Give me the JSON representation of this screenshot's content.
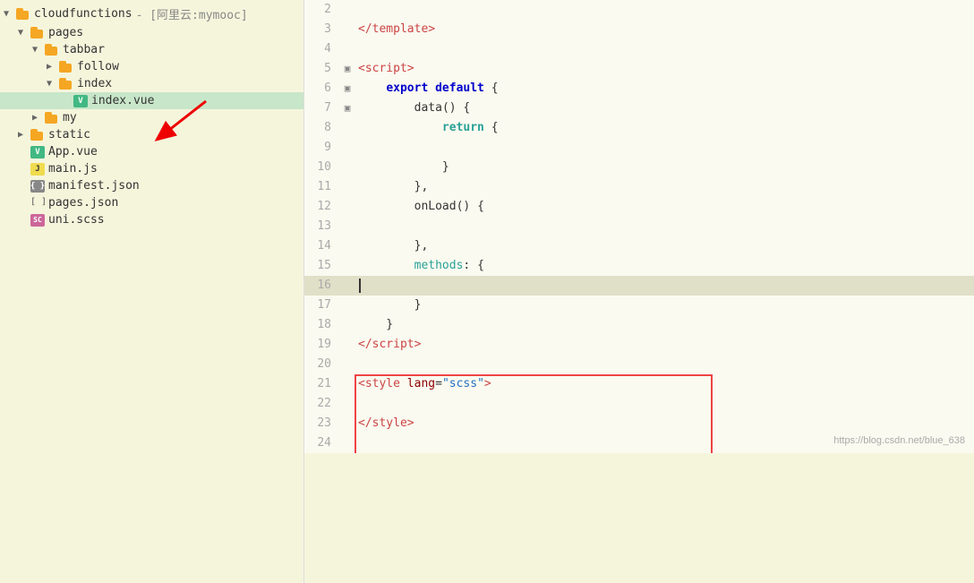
{
  "sidebar": {
    "items": [
      {
        "id": "cloudfunctions",
        "label": "cloudfunctions",
        "suffix": "- [阿里云:mymooc]",
        "type": "folder-open",
        "indent": 0,
        "arrow": "down"
      },
      {
        "id": "pages",
        "label": "pages",
        "type": "folder-open",
        "indent": 1,
        "arrow": "down"
      },
      {
        "id": "tabbar",
        "label": "tabbar",
        "type": "folder-open",
        "indent": 2,
        "arrow": "down"
      },
      {
        "id": "follow",
        "label": "follow",
        "type": "folder-closed",
        "indent": 3,
        "arrow": "right"
      },
      {
        "id": "index",
        "label": "index",
        "type": "folder-open",
        "indent": 3,
        "arrow": "down"
      },
      {
        "id": "index-vue",
        "label": "index.vue",
        "type": "file-vue",
        "indent": 4,
        "arrow": "empty",
        "selected": true
      },
      {
        "id": "my",
        "label": "my",
        "type": "folder-closed",
        "indent": 2,
        "arrow": "right"
      },
      {
        "id": "static",
        "label": "static",
        "type": "folder-closed",
        "indent": 1,
        "arrow": "right"
      },
      {
        "id": "App-vue",
        "label": "App.vue",
        "type": "file-vue",
        "indent": 1,
        "arrow": "empty"
      },
      {
        "id": "main-js",
        "label": "main.js",
        "type": "file-js",
        "indent": 1,
        "arrow": "empty"
      },
      {
        "id": "manifest-json",
        "label": "manifest.json",
        "type": "file-json",
        "indent": 1,
        "arrow": "empty"
      },
      {
        "id": "pages-json",
        "label": "pages.json",
        "type": "file-json",
        "indent": 1,
        "arrow": "empty"
      },
      {
        "id": "uni-scss",
        "label": "uni.scss",
        "type": "file-scss",
        "indent": 1,
        "arrow": "empty"
      }
    ]
  },
  "editor": {
    "lines": [
      {
        "num": 2,
        "fold": "",
        "content": "",
        "type": "plain"
      },
      {
        "num": 3,
        "fold": "",
        "content": "<TEMPLATE_CLOSE>",
        "type": "template-close"
      },
      {
        "num": 4,
        "fold": "",
        "content": "",
        "type": "plain"
      },
      {
        "num": 5,
        "fold": "▣",
        "content": "<SCRIPT_OPEN>",
        "type": "script-open"
      },
      {
        "num": 6,
        "fold": "▣",
        "content": "EXPORT_DEFAULT",
        "type": "export"
      },
      {
        "num": 7,
        "fold": "▣",
        "content": "DATA_FN",
        "type": "data-fn"
      },
      {
        "num": 8,
        "fold": "",
        "content": "RETURN",
        "type": "return"
      },
      {
        "num": 9,
        "fold": "",
        "content": "",
        "type": "plain"
      },
      {
        "num": 10,
        "fold": "",
        "content": "CLOSE_BRACE",
        "type": "close-brace"
      },
      {
        "num": 11,
        "fold": "",
        "content": "CLOSE_BRACE_COMMA",
        "type": "close-brace-comma"
      },
      {
        "num": 12,
        "fold": "",
        "content": "ON_LOAD",
        "type": "onload"
      },
      {
        "num": 13,
        "fold": "",
        "content": "",
        "type": "plain"
      },
      {
        "num": 14,
        "fold": "",
        "content": "CLOSE_BRACE_COMMA2",
        "type": "close-brace-comma2"
      },
      {
        "num": 15,
        "fold": "",
        "content": "METHODS",
        "type": "methods"
      },
      {
        "num": 16,
        "fold": "",
        "content": "CURSOR",
        "type": "cursor",
        "highlighted": true
      },
      {
        "num": 17,
        "fold": "",
        "content": "CLOSE_BRACE3",
        "type": "close-brace3"
      },
      {
        "num": 18,
        "fold": "",
        "content": "CLOSE_BRACE4",
        "type": "close-brace4"
      },
      {
        "num": 19,
        "fold": "",
        "content": "SCRIPT_CLOSE",
        "type": "script-close"
      },
      {
        "num": 20,
        "fold": "",
        "content": "",
        "type": "plain"
      },
      {
        "num": 21,
        "fold": "",
        "content": "STYLE_OPEN",
        "type": "style-open"
      },
      {
        "num": 22,
        "fold": "",
        "content": "",
        "type": "plain"
      },
      {
        "num": 23,
        "fold": "",
        "content": "STYLE_CLOSE",
        "type": "style-close"
      },
      {
        "num": 24,
        "fold": "",
        "content": "",
        "type": "plain"
      }
    ]
  },
  "watermark": "https://blog.csdn.net/blue_638"
}
